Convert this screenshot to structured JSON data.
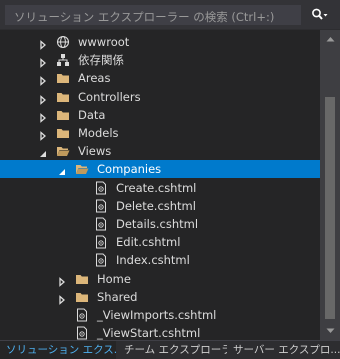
{
  "search": {
    "placeholder": "ソリューション エクスプローラー の検索 (Ctrl+:)"
  },
  "tree": [
    {
      "label": "wwwroot",
      "icon": "globe-icon",
      "state": "collapsed",
      "level": 0
    },
    {
      "label": "依存関係",
      "icon": "dependencies-icon",
      "state": "collapsed",
      "level": 0
    },
    {
      "label": "Areas",
      "icon": "folder-icon",
      "state": "collapsed",
      "level": 0
    },
    {
      "label": "Controllers",
      "icon": "folder-icon",
      "state": "collapsed",
      "level": 0
    },
    {
      "label": "Data",
      "icon": "folder-icon",
      "state": "collapsed",
      "level": 0
    },
    {
      "label": "Models",
      "icon": "folder-icon",
      "state": "collapsed",
      "level": 0
    },
    {
      "label": "Views",
      "icon": "folder-open-icon",
      "state": "expanded",
      "level": 0
    },
    {
      "label": "Companies",
      "icon": "folder-open-icon",
      "state": "expanded",
      "level": 1,
      "selected": true
    },
    {
      "label": "Create.cshtml",
      "icon": "razor-file-icon",
      "state": "none",
      "level": 2
    },
    {
      "label": "Delete.cshtml",
      "icon": "razor-file-icon",
      "state": "none",
      "level": 2
    },
    {
      "label": "Details.cshtml",
      "icon": "razor-file-icon",
      "state": "none",
      "level": 2
    },
    {
      "label": "Edit.cshtml",
      "icon": "razor-file-icon",
      "state": "none",
      "level": 2
    },
    {
      "label": "Index.cshtml",
      "icon": "razor-file-icon",
      "state": "none",
      "level": 2
    },
    {
      "label": "Home",
      "icon": "folder-icon",
      "state": "collapsed",
      "level": 1
    },
    {
      "label": "Shared",
      "icon": "folder-icon",
      "state": "collapsed",
      "level": 1
    },
    {
      "label": "_ViewImports.cshtml",
      "icon": "razor-file-icon",
      "state": "none",
      "level": 1
    },
    {
      "label": "_ViewStart.cshtml",
      "icon": "razor-file-icon",
      "state": "none",
      "level": 1
    }
  ],
  "tabs": [
    {
      "label": "ソリューション エクス...",
      "active": true
    },
    {
      "label": "チーム エクスプローラー",
      "active": false
    },
    {
      "label": "サーバー エクスプロ...",
      "active": false
    }
  ],
  "colors": {
    "background": "#252526",
    "selection": "#007acc",
    "folder": "#dcb67a",
    "active_tab_text": "#4eb0f0"
  }
}
